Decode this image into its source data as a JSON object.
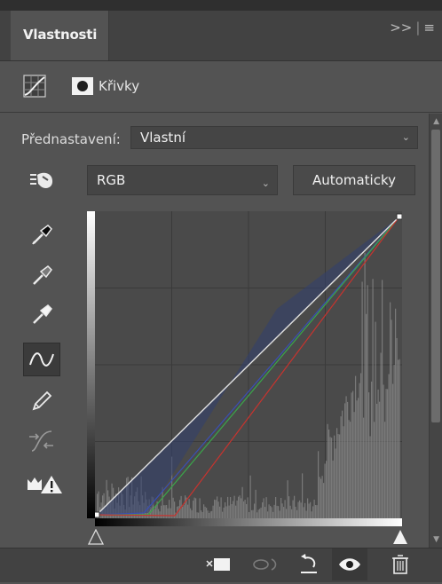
{
  "panel": {
    "tab_title": "Vlastnosti",
    "tab_actions": ">>",
    "tab_menu": "≡"
  },
  "adjustment": {
    "title": "Křivky"
  },
  "preset": {
    "label": "Přednastavení:",
    "value": "Vlastní"
  },
  "channel": {
    "value": "RGB"
  },
  "auto_button": {
    "label": "Automaticky"
  },
  "colors": {
    "panel_bg": "#535353",
    "curve_white": "#e0e0e0",
    "curve_red": "#c8332e",
    "curve_green": "#3aa64a",
    "curve_blue": "#3a4fb4"
  },
  "icons": {
    "curves_icon": "curves-grid-icon",
    "mask_icon": "mask-icon",
    "hand_target": "targeted-adjustment-icon",
    "eyedropper_black": "eyedropper-black-icon",
    "eyedropper_gray": "eyedropper-gray-icon",
    "eyedropper_white": "eyedropper-white-icon",
    "curve_tool": "curve-point-icon",
    "pencil": "pencil-icon",
    "smooth": "smooth-curve-icon",
    "clipping": "clipping-warning-icon",
    "clip_layer": "clip-to-layer-icon",
    "view_previous": "view-previous-icon",
    "reset": "reset-icon",
    "visibility": "eye-icon",
    "delete": "trash-icon"
  }
}
